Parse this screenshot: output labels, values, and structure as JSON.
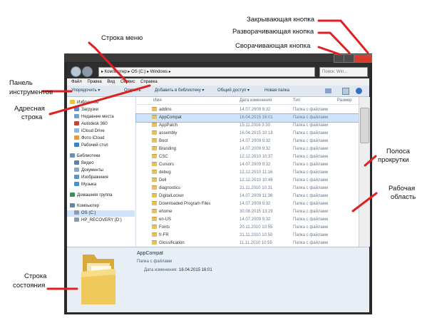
{
  "annotations": {
    "close_button": "Закрывающая кнопка",
    "maximize_button": "Разворачивающая кнопка",
    "minimize_button": "Сворачивающая кнопка",
    "menu_bar": "Строка меню",
    "toolbar_line1": "Панель",
    "toolbar_line2": "инструментов",
    "address_bar_line1": "Адресная",
    "address_bar_line2": "строка",
    "scrollbar_line1": "Полоса",
    "scrollbar_line2": "прокрутки",
    "work_area_line1": "Рабочая",
    "work_area_line2": "область",
    "status_bar_line1": "Строка",
    "status_bar_line2": "состояния"
  },
  "window": {
    "address_path": "▸ Компьютер ▸ OS (C:) ▸ Windows ▸",
    "search_placeholder": "Поиск: Win...",
    "menu": [
      "Файл",
      "Правка",
      "Вид",
      "Сервис",
      "Справка"
    ],
    "toolbar": {
      "organize": "Упорядочить ▾",
      "open": "Открыть",
      "add_to_library": "Добавить в библиотеку ▾",
      "share": "Общий доступ ▾",
      "new_folder": "Новая папка"
    },
    "nav_pane": [
      {
        "label": "Избранное",
        "icon": "star-icon",
        "color": "#e8c440",
        "top": true
      },
      {
        "label": "Загрузки",
        "icon": "downloads-icon",
        "color": "#5d8fd0"
      },
      {
        "label": "Недавние места",
        "icon": "recent-places-icon",
        "color": "#7aa0c8"
      },
      {
        "label": "Autodesk 360",
        "icon": "cloud-icon",
        "color": "#c04a3a"
      },
      {
        "label": "iCloud Drive",
        "icon": "cloud-icon",
        "color": "#8fb6e2"
      },
      {
        "label": "Фото iCloud",
        "icon": "photos-icon",
        "color": "#e39a3a"
      },
      {
        "label": "Рабочий стол",
        "icon": "desktop-icon",
        "color": "#3e7fc7"
      },
      {
        "label": "",
        "spacer": true
      },
      {
        "label": "Библиотеки",
        "icon": "library-icon",
        "color": "#6d8fb5",
        "top": true
      },
      {
        "label": "Видео",
        "icon": "video-icon",
        "color": "#5f7fa8"
      },
      {
        "label": "Документы",
        "icon": "documents-icon",
        "color": "#8ea6c2"
      },
      {
        "label": "Изображения",
        "icon": "pictures-icon",
        "color": "#5a95c6"
      },
      {
        "label": "Музыка",
        "icon": "music-icon",
        "color": "#4f8fcf"
      },
      {
        "label": "",
        "spacer": true
      },
      {
        "label": "Домашняя группа",
        "icon": "homegroup-icon",
        "color": "#3f8e52",
        "top": true
      },
      {
        "label": "",
        "spacer": true
      },
      {
        "label": "Компьютер",
        "icon": "computer-icon",
        "color": "#6a84a6",
        "top": true
      },
      {
        "label": "OS (C:)",
        "icon": "drive-icon",
        "color": "#8a9bb0",
        "selected": true
      },
      {
        "label": "HP_RECOVERY (D:)",
        "icon": "drive-icon",
        "color": "#8a9bb0"
      }
    ],
    "columns": [
      "Имя",
      "Дата изменения",
      "Тип",
      "Размер"
    ],
    "files": [
      {
        "name": "addins",
        "date": "14.07.2009 9:32",
        "type": "Папка с файлами"
      },
      {
        "name": "AppCompat",
        "date": "16.04.2015 16:01",
        "type": "Папка с файлами",
        "selected": true
      },
      {
        "name": "AppPatch",
        "date": "15.11.2016 3:30",
        "type": "Папка с файлами"
      },
      {
        "name": "assembly",
        "date": "16.04.2015 10:18",
        "type": "Папка с файлами"
      },
      {
        "name": "Boot",
        "date": "14.07.2009 9:32",
        "type": "Папка с файлами"
      },
      {
        "name": "Branding",
        "date": "14.07.2009 9:32",
        "type": "Папка с файлами"
      },
      {
        "name": "CSC",
        "date": "12.12.2010 10:37",
        "type": "Папка с файлами"
      },
      {
        "name": "Cursors",
        "date": "14.07.2009 9:32",
        "type": "Папка с файлами"
      },
      {
        "name": "debug",
        "date": "12.12.2010 11:16",
        "type": "Папка с файлами"
      },
      {
        "name": "Dell",
        "date": "12.12.2010 10:46",
        "type": "Папка с файлами"
      },
      {
        "name": "diagnostics",
        "date": "21.11.2010 10:31",
        "type": "Папка с файлами"
      },
      {
        "name": "DigitalLocker",
        "date": "14.07.2009 11:36",
        "type": "Папка с файлами"
      },
      {
        "name": "Downloaded Program Files",
        "date": "14.07.2009 9:32",
        "type": "Папка с файлами"
      },
      {
        "name": "ehome",
        "date": "30.08.2015 13:29",
        "type": "Папка с файлами"
      },
      {
        "name": "en-US",
        "date": "14.07.2009 9:32",
        "type": "Папка с файлами"
      },
      {
        "name": "Fonts",
        "date": "20.11.2010 10:55",
        "type": "Папка с файлами"
      },
      {
        "name": "fr-FR",
        "date": "21.11.2010 10:50",
        "type": "Папка с файлами"
      },
      {
        "name": "Glossification",
        "date": "11.11.2010 10:55",
        "type": "Папка с файлами"
      }
    ],
    "details": {
      "name": "AppCompat",
      "type": "Папка с файлами",
      "modified_label": "Дата изменения:",
      "modified_value": "16.04.2015 16:01"
    }
  },
  "colors": {
    "accent_red": "#e02020",
    "window_frame": "#2a2a2a",
    "toolbar": "#dfe7f1",
    "details_pane": "#e7eef6"
  }
}
